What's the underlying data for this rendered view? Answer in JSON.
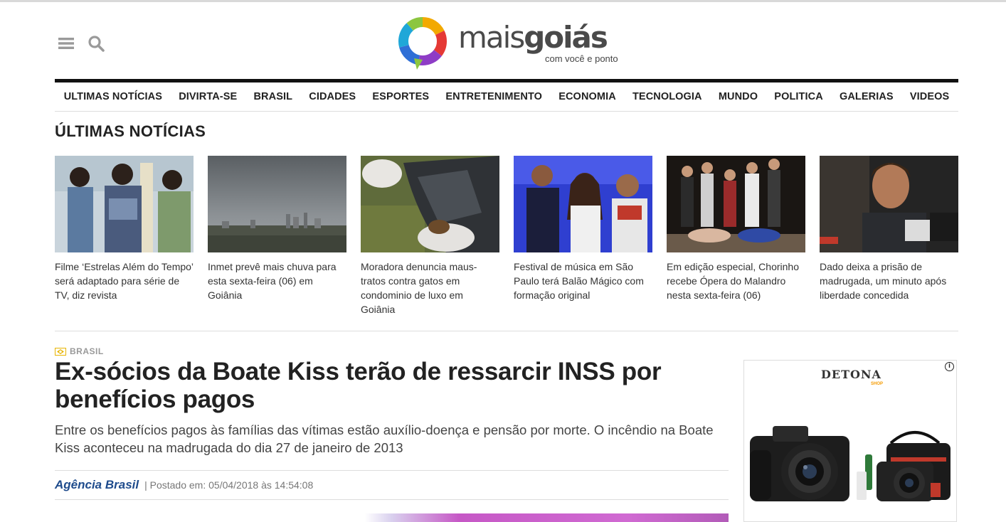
{
  "header": {
    "logo_text_light": "mais",
    "logo_text_bold": "goiás",
    "logo_tagline": "com você e ponto",
    "menu_icon": "hamburger-menu-icon",
    "search_icon": "search-icon"
  },
  "nav": {
    "items": [
      {
        "label": "ULTIMAS NOTÍCIAS"
      },
      {
        "label": "DIVIRTA-SE"
      },
      {
        "label": "BRASIL"
      },
      {
        "label": "CIDADES"
      },
      {
        "label": "ESPORTES"
      },
      {
        "label": "ENTRETENIMENTO"
      },
      {
        "label": "ECONOMIA"
      },
      {
        "label": "TECNOLOGIA"
      },
      {
        "label": "MUNDO"
      },
      {
        "label": "POLITICA"
      },
      {
        "label": "GALERIAS"
      },
      {
        "label": "VIDEOS"
      }
    ]
  },
  "latest": {
    "title": "ÚLTIMAS NOTÍCIAS",
    "cards": [
      {
        "text": "Filme ‘Estrelas Além do Tempo’ será adaptado para série de TV, diz revista"
      },
      {
        "text": "Inmet prevê mais chuva para esta sexta-feira (06) em Goiânia"
      },
      {
        "text": "Moradora denuncia maus-tratos contra gatos em condominio de luxo em Goiânia"
      },
      {
        "text": "Festival de música em São Paulo terá Balão Mágico com formação original"
      },
      {
        "text": "Em edição especial, Chorinho recebe Ópera do Malandro nesta sexta-feira (06)"
      },
      {
        "text": "Dado deixa a prisão de madrugada, um minuto após liberdade concedida"
      }
    ]
  },
  "article": {
    "category": "BRASIL",
    "headline": "Ex-sócios da Boate Kiss terão de ressarcir INSS por benefícios pagos",
    "lead": "Entre os benefícios pagos às famílias das vítimas estão auxílio-doença e pensão por morte. O incêndio na Boate Kiss aconteceu na madrugada do dia 27 de janeiro de 2013",
    "source": "Agência Brasil",
    "posted": "| Postado em: 05/04/2018 às 14:54:08"
  },
  "ad": {
    "brand": "DETONA",
    "brand_sub": "SHOP",
    "info_icon": "ad-info-icon"
  },
  "colors": {
    "accent_blue": "#1e4b8c",
    "category_gold": "#e8b400",
    "text_dark": "#222222"
  }
}
